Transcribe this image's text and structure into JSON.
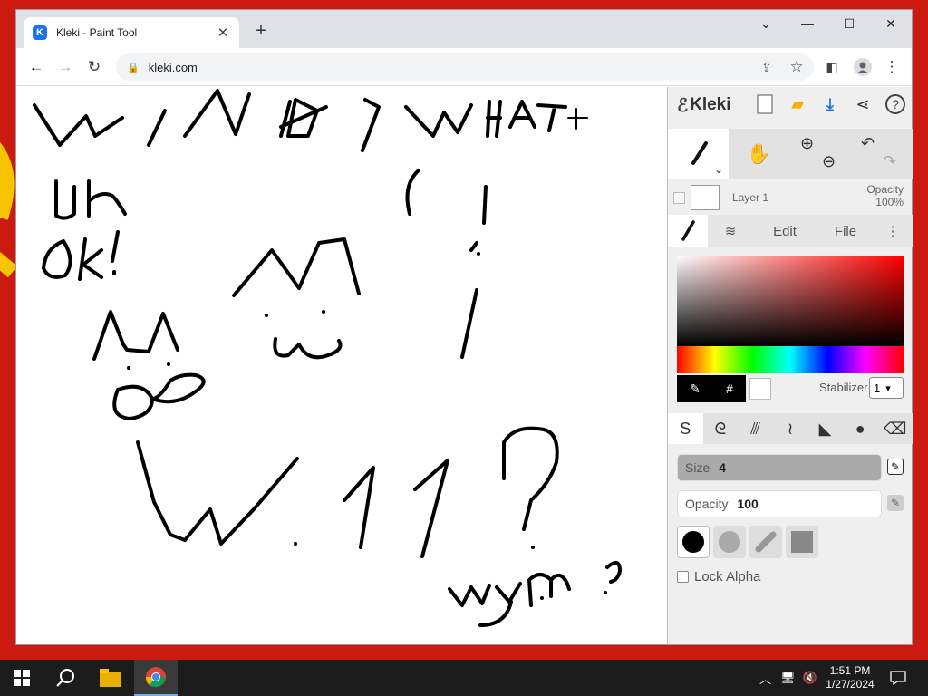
{
  "window": {
    "tab_title": "Kleki - Paint Tool",
    "url": "kleki.com"
  },
  "canvas_text": {
    "left_text": "WIN 10 1 WHAT",
    "uh": "uh",
    "ok": "ok!",
    "w11": "W11?",
    "wym": "wym ?"
  },
  "panel": {
    "logo": "Kleki",
    "layer_name": "Layer 1",
    "opacity_label": "Opacity",
    "opacity_value": "100%",
    "tabs": {
      "edit": "Edit",
      "file": "File"
    },
    "hash": "#",
    "stabilizer_label": "Stabilizer",
    "stabilizer_value": "1",
    "size_label": "Size",
    "size_value": "4",
    "brush_opacity_label": "Opacity",
    "brush_opacity_value": "100",
    "lock_alpha": "Lock Alpha"
  },
  "taskbar": {
    "time": "1:51 PM",
    "date": "1/27/2024"
  }
}
